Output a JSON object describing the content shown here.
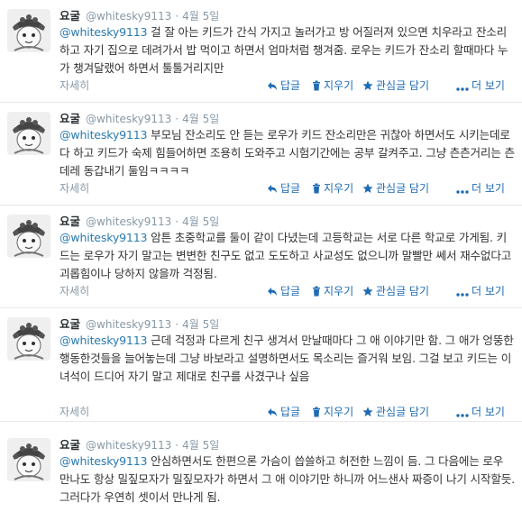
{
  "actions": {
    "detail": "자세히",
    "reply": "답글",
    "delete": "지우기",
    "favorite": "관심글 담기",
    "more": "더 보기"
  },
  "tweets": [
    {
      "name": "요굴",
      "handle": "@whitesky9113",
      "sep": "·",
      "date": "4월 5일",
      "mention": "@whitesky9113",
      "text": " 걸 잘 아는 키드가 간식 가지고 놀러가고 방 어질러져 있으면 치우라고 잔소리하고 자기 집으로 데려가서 밥 먹이고 하면서 엄마처럼 챙겨줌. 로우는 키드가 잔소리 할때마다 누가 챙겨달랬어 하면서 툴툴거리지만"
    },
    {
      "name": "요굴",
      "handle": "@whitesky9113",
      "sep": "·",
      "date": "4월 5일",
      "mention": "@whitesky9113",
      "text": " 부모님 잔소리도 안 듣는 로우가 키드 잔소리만은 귀찮아 하면서도 시키는데로 다 하고 키드가 숙제 힘들어하면 조용히 도와주고 시험기간에는 공부 갈켜주고. 그냥 츤츤거리는 츤데레 동갑내기 둘임ㅋㅋㅋㅋ"
    },
    {
      "name": "요굴",
      "handle": "@whitesky9113",
      "sep": "·",
      "date": "4월 5일",
      "mention": "@whitesky9113",
      "text": " 암튼 초중학교를 둘이 같이 다녔는데 고등학교는 서로 다른 학교로 가게됨. 키드는 로우가 자기 말고는 변변한 친구도 없고 도도하고 사교성도 없으니까 말빨만 쎄서 재수없다고 괴롭힘이나 당하지 않을까 걱정됨."
    },
    {
      "name": "요굴",
      "handle": "@whitesky9113",
      "sep": "·",
      "date": "4월 5일",
      "mention": "@whitesky9113",
      "text": " 근데 걱정과 다르게 친구 생겨서 만날때마다 그 애 이야기만 함. 그 애가 엉뚱한 행동한것들을 늘어놓는데 그냥 바보라고 설명하면서도 목소리는 즐거워 보임. 그걸 보고 키드는 이녀석이 드디어 자기 말고 제대로 친구를 사겼구나 싶음"
    },
    {
      "name": "요굴",
      "handle": "@whitesky9113",
      "sep": "·",
      "date": "4월 5일",
      "mention": "@whitesky9113",
      "text": " 안심하면서도 한편으론 가슴이 씁쓸하고 허전한 느낌이 듬. 그 다음에는 로우 만나도 항상 밀짚모자가 밀짚모자가 하면서 그 애 이야기만 하니까 어느샌사 짜증이 나기 시작할듯. 그러다가 우연히 셋이서 만나게 됨."
    }
  ]
}
